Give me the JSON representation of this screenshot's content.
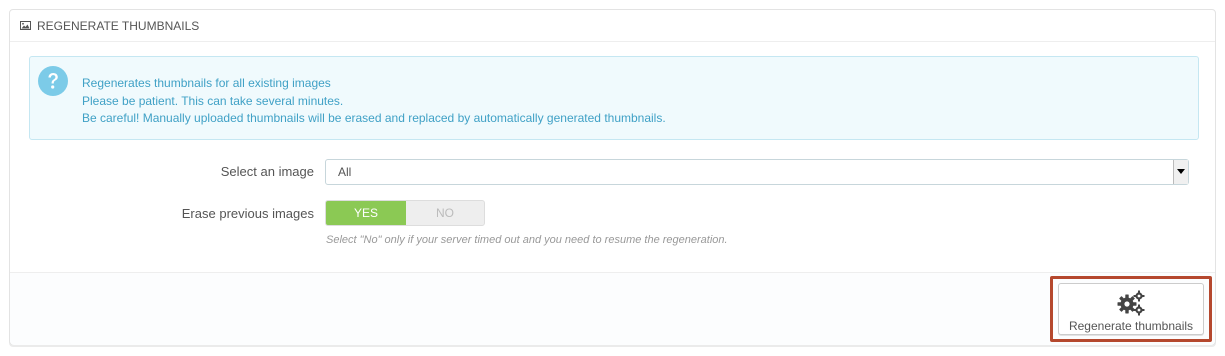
{
  "panel": {
    "title": "REGENERATE THUMBNAILS",
    "icon": "image-icon"
  },
  "alert": {
    "icon": "question-icon",
    "lines": [
      "Regenerates thumbnails for all existing images",
      "Please be patient. This can take several minutes.",
      "Be careful! Manually uploaded thumbnails will be erased and replaced by automatically generated thumbnails."
    ],
    "color": "#40a1c6",
    "background": "#f0fafd"
  },
  "form": {
    "select_label": "Select an image",
    "select_value": "All",
    "erase_label": "Erase previous images",
    "erase_yes": "YES",
    "erase_no": "NO",
    "erase_selected": "YES",
    "erase_help": "Select \"No\" only if your server timed out and you need to resume the regeneration."
  },
  "footer": {
    "button_label": "Regenerate thumbnails",
    "button_icon": "gears-icon",
    "highlight_color": "#b5482e"
  },
  "colors": {
    "switch_on": "#8bc954"
  }
}
